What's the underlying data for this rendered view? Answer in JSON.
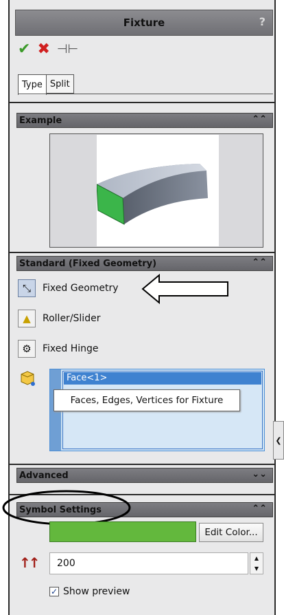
{
  "panel": {
    "title": "Fixture",
    "help_label": "?",
    "ok_icon": "check-icon",
    "cancel_icon": "x-icon",
    "pin_icon": "pushpin-icon"
  },
  "tabs": [
    {
      "label": "Type",
      "active": true
    },
    {
      "label": "Split",
      "active": false
    }
  ],
  "sections": {
    "example": {
      "title": "Example",
      "expanded": true
    },
    "standard": {
      "title": "Standard (Fixed Geometry)",
      "expanded": true
    },
    "advanced": {
      "title": "Advanced",
      "expanded": false
    },
    "symbol": {
      "title": "Symbol Settings",
      "expanded": true
    }
  },
  "options": [
    {
      "label": "Fixed Geometry",
      "selected": true
    },
    {
      "label": "Roller/Slider",
      "selected": false
    },
    {
      "label": "Fixed Hinge",
      "selected": false
    }
  ],
  "selection": {
    "item": "Face<1>",
    "tooltip": "Faces, Edges, Vertices for Fixture"
  },
  "symbol": {
    "color": "#63b83d",
    "edit_color_label": "Edit Color...",
    "size_value": "200",
    "show_preview_label": "Show preview",
    "show_preview_checked": true
  },
  "colors": {
    "header": "#6f6f74",
    "selection": "#3f82d0",
    "accent_arrow": "#000000"
  }
}
